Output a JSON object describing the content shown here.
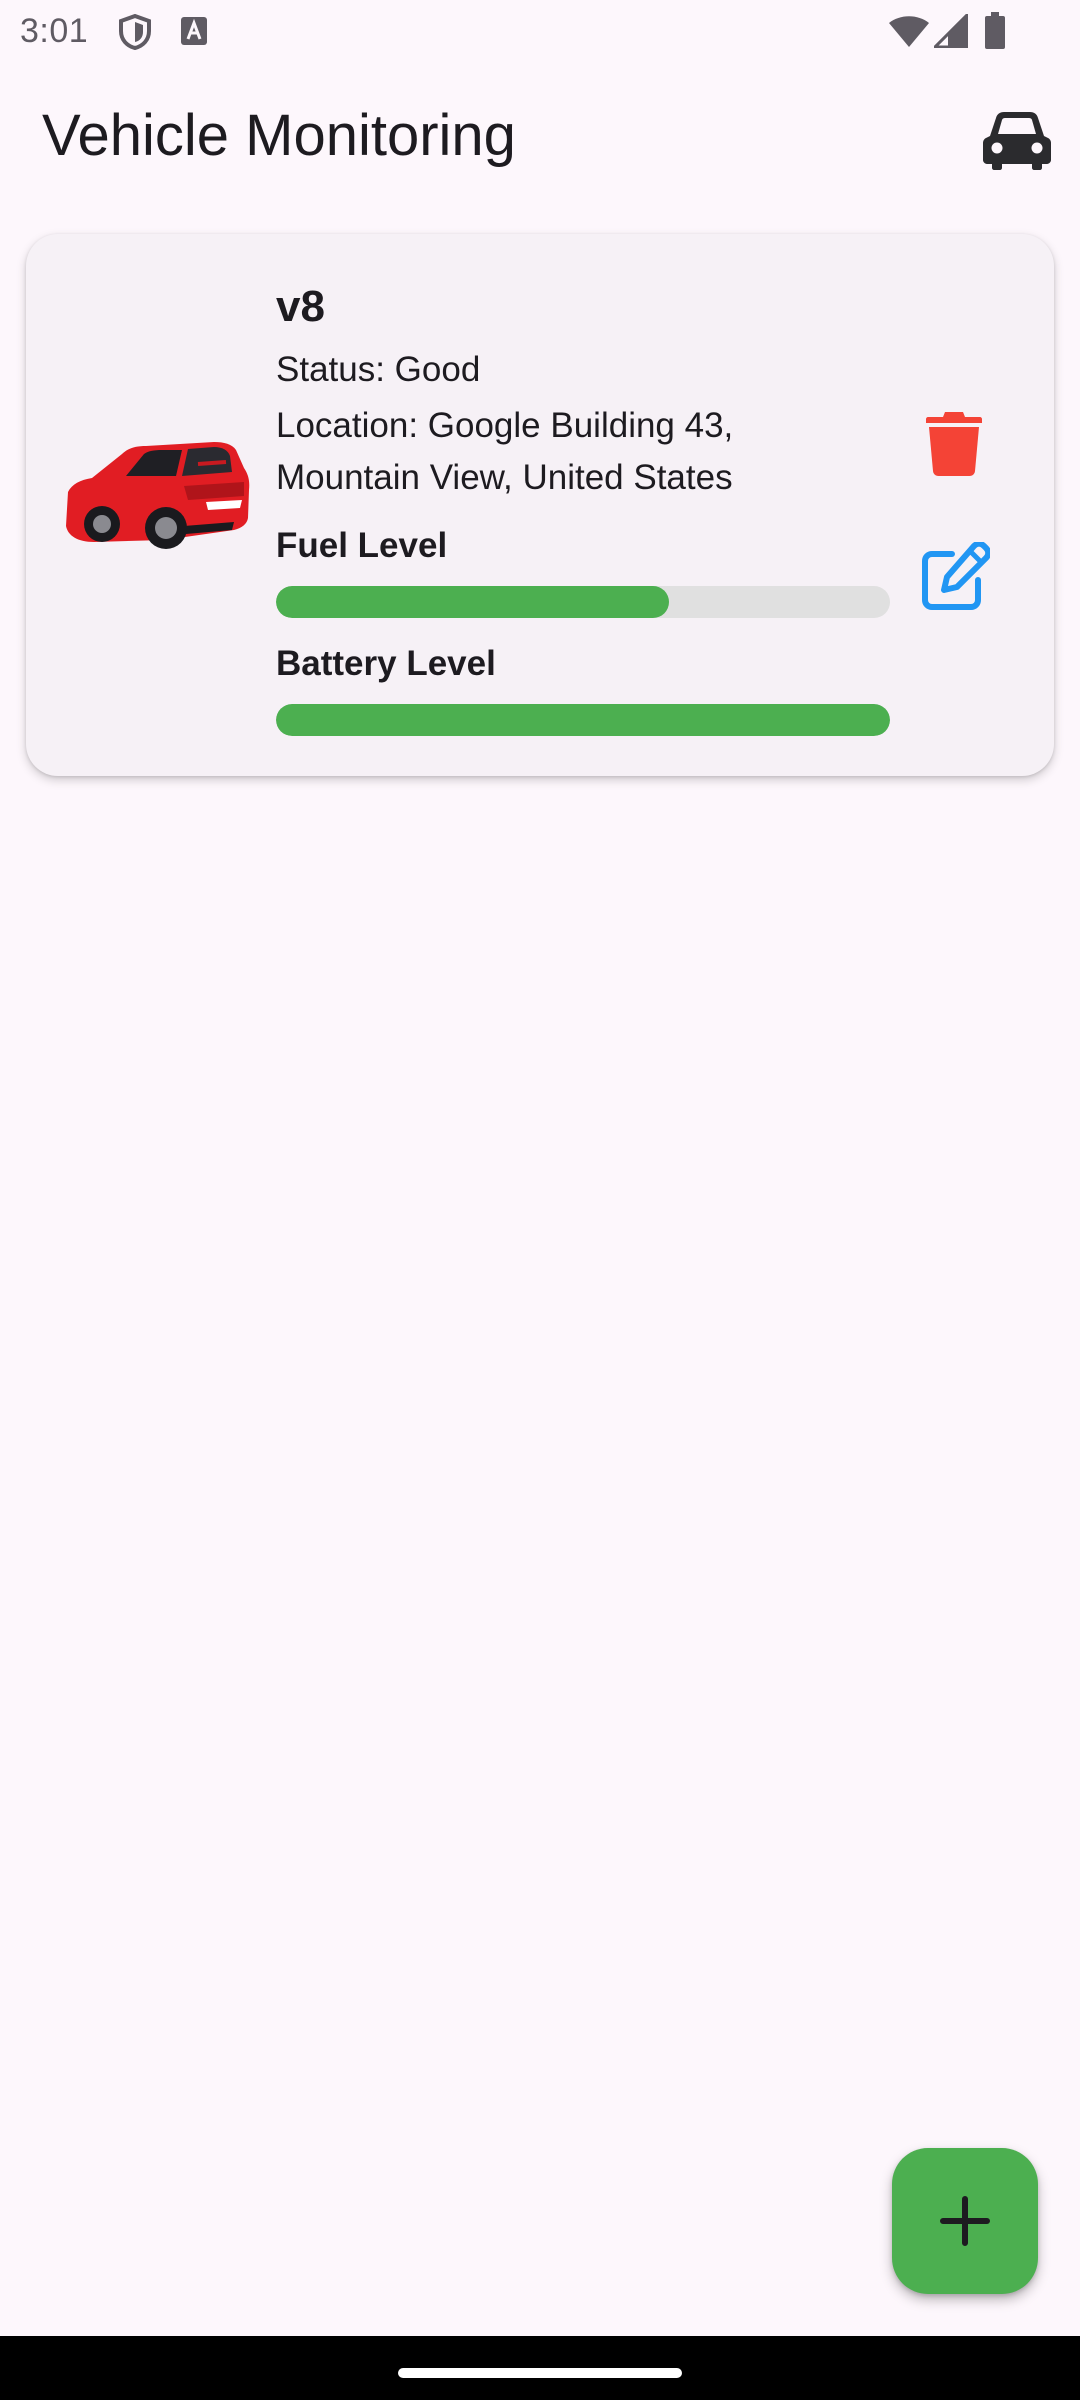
{
  "status_bar": {
    "time": "3:01",
    "icons": [
      "shield-icon",
      "text-a-icon",
      "wifi-icon",
      "signal-icon",
      "battery-icon"
    ]
  },
  "app_bar": {
    "title": "Vehicle Monitoring",
    "action_icon": "car-icon"
  },
  "vehicles": [
    {
      "name": "v8",
      "status": "Status: Good",
      "location": "Location: Google Building 43, Mountain View, United States",
      "image": "red-hatchback-car-image",
      "fuel_label": "Fuel Level",
      "fuel_level": 0.64,
      "battery_label": "Battery Level",
      "battery_level": 1.0,
      "actions": [
        "delete-icon",
        "edit-icon"
      ]
    }
  ],
  "fab": {
    "icon": "plus-icon"
  },
  "colors": {
    "background": "#fdf7fc",
    "card": "#f6f1f6",
    "progress_fill": "#4caf50",
    "progress_track": "#e0e0e0",
    "delete": "#f44336",
    "edit": "#2196f3",
    "fab": "#4caf50"
  }
}
